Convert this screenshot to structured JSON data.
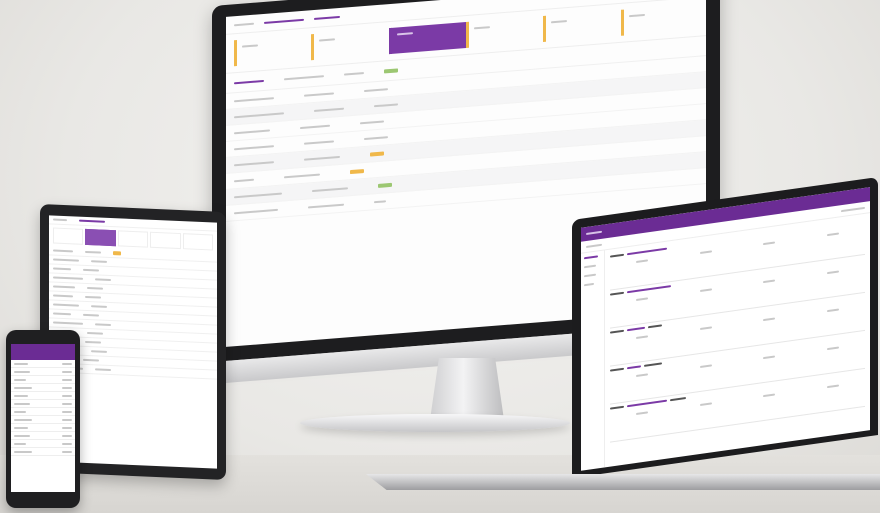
{
  "scene": {
    "description_items": [
      "desktop monitor",
      "tablet",
      "smartphone",
      "laptop"
    ],
    "accent_color": "#7b3aa6",
    "highlight_orange": "#f0b84a",
    "highlight_green": "#9cc772"
  },
  "desktop": {
    "stat_count": 6,
    "active_stat_index": 2,
    "row_count": 8
  },
  "tablet": {
    "row_count": 18
  },
  "phone": {
    "row_count": 12
  },
  "laptop": {
    "card_count": 5
  }
}
